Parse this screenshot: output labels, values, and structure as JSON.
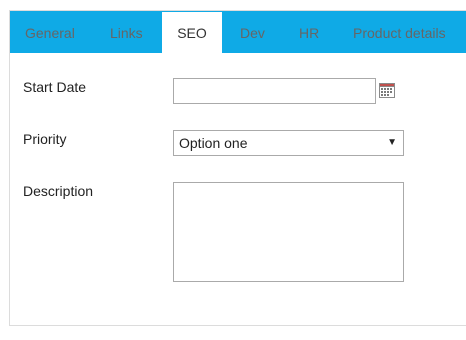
{
  "tabs": [
    {
      "label": "General",
      "active": false
    },
    {
      "label": "Links",
      "active": false
    },
    {
      "label": "SEO",
      "active": true
    },
    {
      "label": "Dev",
      "active": false
    },
    {
      "label": "HR",
      "active": false
    },
    {
      "label": "Product details",
      "active": false
    }
  ],
  "form": {
    "start_date": {
      "label": "Start Date",
      "value": ""
    },
    "priority": {
      "label": "Priority",
      "selected": "Option one"
    },
    "description": {
      "label": "Description",
      "value": ""
    }
  },
  "colors": {
    "tabbar_bg": "#0faae6",
    "active_tab_bg": "#ffffff",
    "inactive_tab_text": "#666666"
  },
  "icons": {
    "date_picker": "calendar-icon",
    "select_arrow": "chevron-down-icon"
  }
}
